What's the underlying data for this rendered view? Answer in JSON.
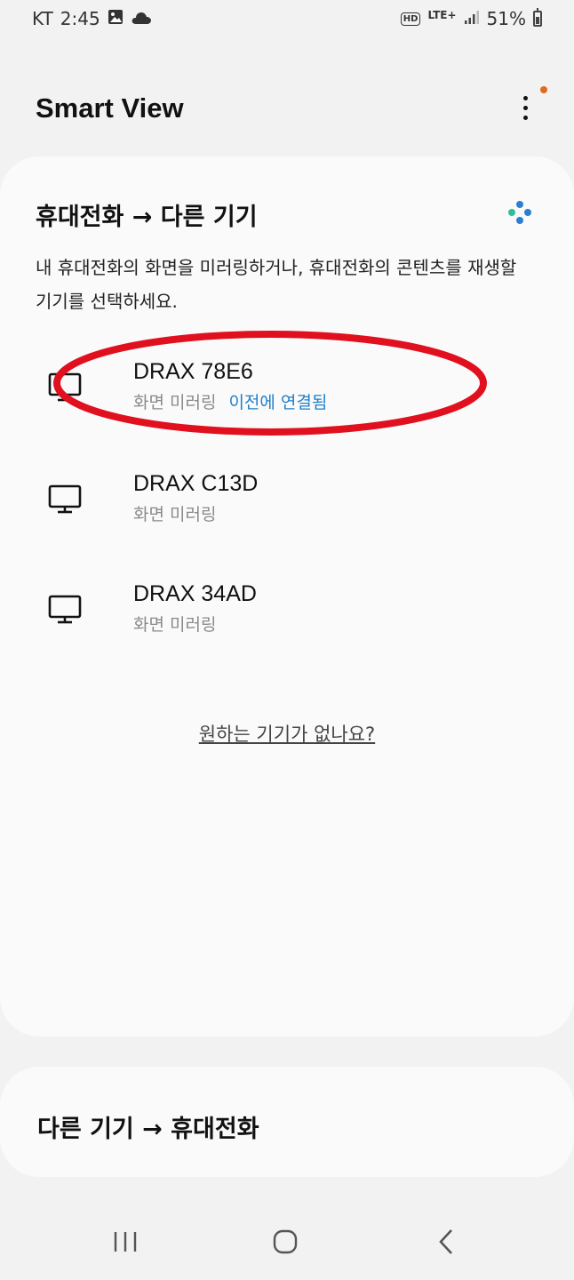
{
  "status_bar": {
    "carrier": "KT",
    "time": "2:45",
    "hd": "HD",
    "network": "LTE+",
    "battery": "51%"
  },
  "app": {
    "title": "Smart View"
  },
  "cast_section": {
    "title": "휴대전화 → 다른 기기",
    "description": "내 휴대전화의 화면을 미러링하거나, 휴대전화의 콘텐츠를 재생할 기기를 선택하세요.",
    "devices": [
      {
        "name": "DRAX 78E6",
        "mode": "화면 미러링",
        "status": "이전에 연결됨",
        "highlighted": true
      },
      {
        "name": "DRAX C13D",
        "mode": "화면 미러링",
        "status": ""
      },
      {
        "name": "DRAX 34AD",
        "mode": "화면 미러링",
        "status": ""
      }
    ],
    "help_link": "원하는 기기가 없나요?"
  },
  "receive_section": {
    "title": "다른 기기 → 휴대전화"
  },
  "colors": {
    "background": "#f2f2f2",
    "card": "#fafafa",
    "link_blue": "#1f7fc8",
    "annotation_red": "#e0101e",
    "notification_orange": "#e06a1f"
  },
  "icons": [
    "gallery-icon",
    "cloud-icon",
    "signal-icon",
    "battery-icon",
    "more-options-icon",
    "smartthings-icon",
    "tv-icon",
    "recent-apps-icon",
    "home-icon",
    "back-icon"
  ]
}
